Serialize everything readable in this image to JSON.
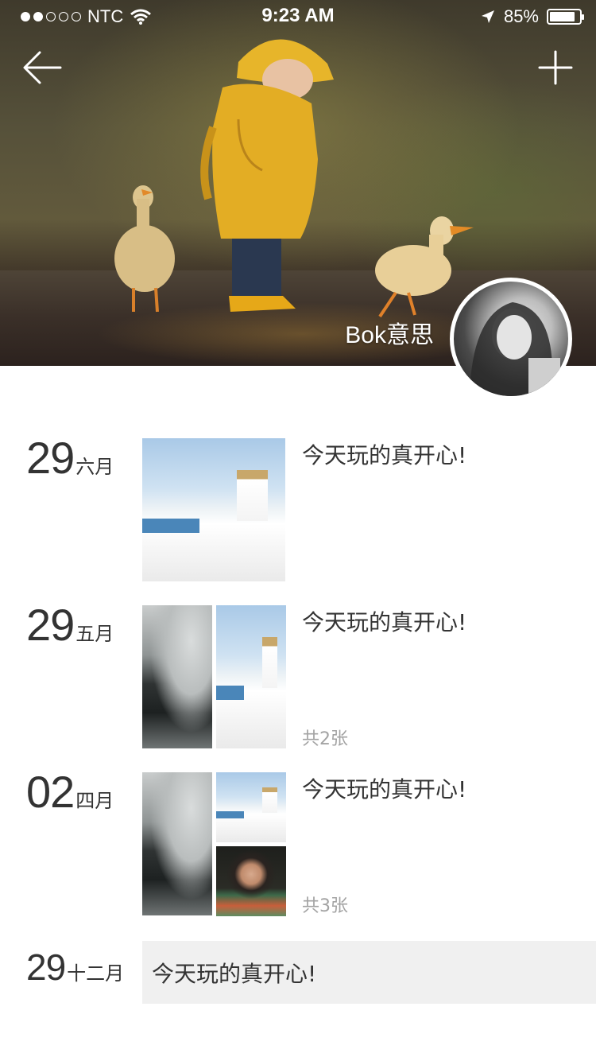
{
  "status_bar": {
    "signal_dots_filled": 2,
    "signal_dots_total": 5,
    "carrier": "NTC",
    "time": "9:23 AM",
    "battery": "85%",
    "battery_level": 0.85
  },
  "nav": {
    "back_icon": "arrow-left-icon",
    "add_icon": "plus-icon"
  },
  "profile": {
    "username": "Bok意思"
  },
  "timeline": [
    {
      "day": "29",
      "month": "六月",
      "text": "今天玩的真开心!",
      "photos": [
        "town"
      ]
    },
    {
      "day": "29",
      "month": "五月",
      "text": "今天玩的真开心!",
      "photos": [
        "dark",
        "town"
      ],
      "count": "共2张"
    },
    {
      "day": "02",
      "month": "四月",
      "text": "今天玩的真开心!",
      "photos": [
        "dark",
        "town",
        "girl"
      ],
      "count": "共3张"
    },
    {
      "day": "29",
      "month": "十二月",
      "text": "今天玩的真开心!"
    }
  ]
}
